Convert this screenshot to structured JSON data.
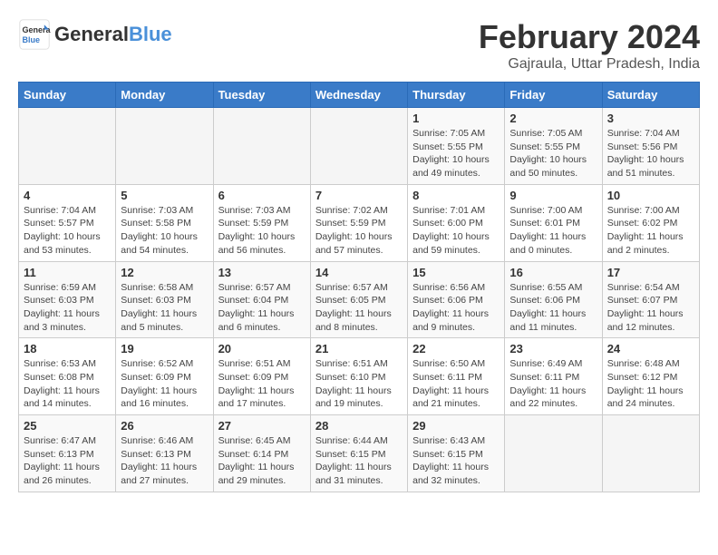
{
  "header": {
    "logo_text_general": "General",
    "logo_text_blue": "Blue",
    "title": "February 2024",
    "subtitle": "Gajraula, Uttar Pradesh, India"
  },
  "days_of_week": [
    "Sunday",
    "Monday",
    "Tuesday",
    "Wednesday",
    "Thursday",
    "Friday",
    "Saturday"
  ],
  "weeks": [
    [
      {
        "day": "",
        "info": ""
      },
      {
        "day": "",
        "info": ""
      },
      {
        "day": "",
        "info": ""
      },
      {
        "day": "",
        "info": ""
      },
      {
        "day": "1",
        "info": "Sunrise: 7:05 AM\nSunset: 5:55 PM\nDaylight: 10 hours\nand 49 minutes."
      },
      {
        "day": "2",
        "info": "Sunrise: 7:05 AM\nSunset: 5:55 PM\nDaylight: 10 hours\nand 50 minutes."
      },
      {
        "day": "3",
        "info": "Sunrise: 7:04 AM\nSunset: 5:56 PM\nDaylight: 10 hours\nand 51 minutes."
      }
    ],
    [
      {
        "day": "4",
        "info": "Sunrise: 7:04 AM\nSunset: 5:57 PM\nDaylight: 10 hours\nand 53 minutes."
      },
      {
        "day": "5",
        "info": "Sunrise: 7:03 AM\nSunset: 5:58 PM\nDaylight: 10 hours\nand 54 minutes."
      },
      {
        "day": "6",
        "info": "Sunrise: 7:03 AM\nSunset: 5:59 PM\nDaylight: 10 hours\nand 56 minutes."
      },
      {
        "day": "7",
        "info": "Sunrise: 7:02 AM\nSunset: 5:59 PM\nDaylight: 10 hours\nand 57 minutes."
      },
      {
        "day": "8",
        "info": "Sunrise: 7:01 AM\nSunset: 6:00 PM\nDaylight: 10 hours\nand 59 minutes."
      },
      {
        "day": "9",
        "info": "Sunrise: 7:00 AM\nSunset: 6:01 PM\nDaylight: 11 hours\nand 0 minutes."
      },
      {
        "day": "10",
        "info": "Sunrise: 7:00 AM\nSunset: 6:02 PM\nDaylight: 11 hours\nand 2 minutes."
      }
    ],
    [
      {
        "day": "11",
        "info": "Sunrise: 6:59 AM\nSunset: 6:03 PM\nDaylight: 11 hours\nand 3 minutes."
      },
      {
        "day": "12",
        "info": "Sunrise: 6:58 AM\nSunset: 6:03 PM\nDaylight: 11 hours\nand 5 minutes."
      },
      {
        "day": "13",
        "info": "Sunrise: 6:57 AM\nSunset: 6:04 PM\nDaylight: 11 hours\nand 6 minutes."
      },
      {
        "day": "14",
        "info": "Sunrise: 6:57 AM\nSunset: 6:05 PM\nDaylight: 11 hours\nand 8 minutes."
      },
      {
        "day": "15",
        "info": "Sunrise: 6:56 AM\nSunset: 6:06 PM\nDaylight: 11 hours\nand 9 minutes."
      },
      {
        "day": "16",
        "info": "Sunrise: 6:55 AM\nSunset: 6:06 PM\nDaylight: 11 hours\nand 11 minutes."
      },
      {
        "day": "17",
        "info": "Sunrise: 6:54 AM\nSunset: 6:07 PM\nDaylight: 11 hours\nand 12 minutes."
      }
    ],
    [
      {
        "day": "18",
        "info": "Sunrise: 6:53 AM\nSunset: 6:08 PM\nDaylight: 11 hours\nand 14 minutes."
      },
      {
        "day": "19",
        "info": "Sunrise: 6:52 AM\nSunset: 6:09 PM\nDaylight: 11 hours\nand 16 minutes."
      },
      {
        "day": "20",
        "info": "Sunrise: 6:51 AM\nSunset: 6:09 PM\nDaylight: 11 hours\nand 17 minutes."
      },
      {
        "day": "21",
        "info": "Sunrise: 6:51 AM\nSunset: 6:10 PM\nDaylight: 11 hours\nand 19 minutes."
      },
      {
        "day": "22",
        "info": "Sunrise: 6:50 AM\nSunset: 6:11 PM\nDaylight: 11 hours\nand 21 minutes."
      },
      {
        "day": "23",
        "info": "Sunrise: 6:49 AM\nSunset: 6:11 PM\nDaylight: 11 hours\nand 22 minutes."
      },
      {
        "day": "24",
        "info": "Sunrise: 6:48 AM\nSunset: 6:12 PM\nDaylight: 11 hours\nand 24 minutes."
      }
    ],
    [
      {
        "day": "25",
        "info": "Sunrise: 6:47 AM\nSunset: 6:13 PM\nDaylight: 11 hours\nand 26 minutes."
      },
      {
        "day": "26",
        "info": "Sunrise: 6:46 AM\nSunset: 6:13 PM\nDaylight: 11 hours\nand 27 minutes."
      },
      {
        "day": "27",
        "info": "Sunrise: 6:45 AM\nSunset: 6:14 PM\nDaylight: 11 hours\nand 29 minutes."
      },
      {
        "day": "28",
        "info": "Sunrise: 6:44 AM\nSunset: 6:15 PM\nDaylight: 11 hours\nand 31 minutes."
      },
      {
        "day": "29",
        "info": "Sunrise: 6:43 AM\nSunset: 6:15 PM\nDaylight: 11 hours\nand 32 minutes."
      },
      {
        "day": "",
        "info": ""
      },
      {
        "day": "",
        "info": ""
      }
    ]
  ]
}
